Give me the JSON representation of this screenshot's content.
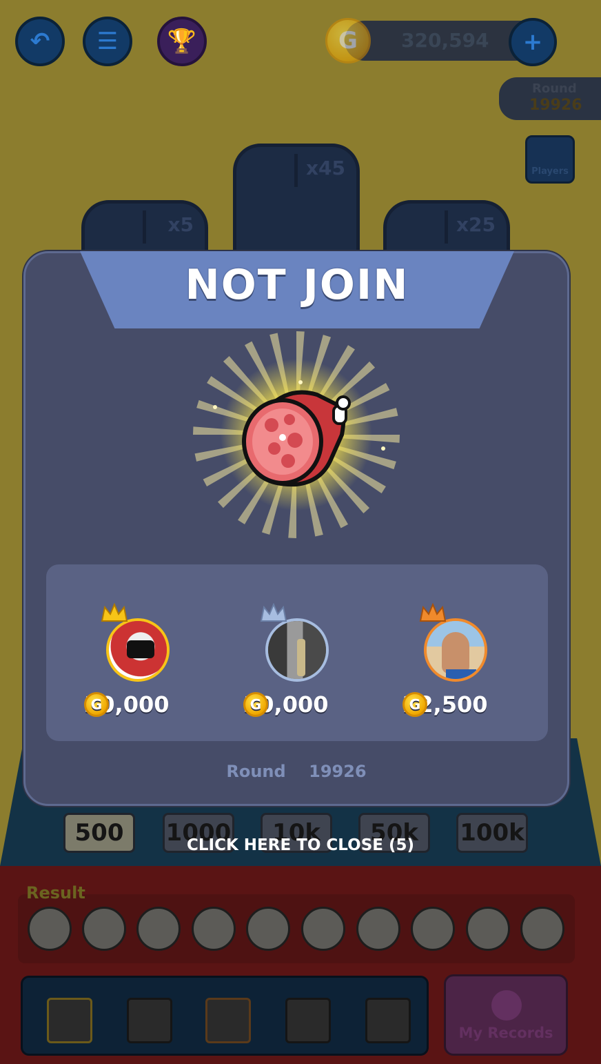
{
  "header": {
    "coins": "320,594",
    "round_label": "Round",
    "round_number": "19926",
    "players_label": "Players"
  },
  "food_boxes": [
    {
      "multiplier": "x5",
      "icon": "lettuce-icon"
    },
    {
      "multiplier": "x45",
      "icon": "chicken-icon"
    },
    {
      "multiplier": "x25",
      "icon": "shrimp-icon"
    }
  ],
  "chips": [
    "500",
    "1000",
    "10k",
    "50k",
    "100k"
  ],
  "result": {
    "label": "Result",
    "items": [
      "meat-icon",
      "watermelon-icon",
      "pizza-icon",
      "lettuce-icon",
      "lettuce-icon",
      "pizza-icon",
      "lettuce-icon",
      "pizza-icon",
      "burger-icon",
      "pizza-icon"
    ]
  },
  "my_records_label": "My Records",
  "modal": {
    "title": "NOT  JOIN",
    "prize_icon": "ham-icon",
    "winners": [
      {
        "rank": "gold",
        "amount": "30,000"
      },
      {
        "rank": "silver",
        "amount": "30,000"
      },
      {
        "rank": "bronze",
        "amount": "22,500"
      }
    ],
    "round_label": "Round",
    "round_number": "19926"
  },
  "close_hint": "CLICK HERE TO CLOSE (5)",
  "colors": {
    "modal_bg": "#464c68",
    "banner": "#6a84c0",
    "gold": "#f7c417",
    "silver": "#a7bde0",
    "bronze": "#f08a2c"
  }
}
